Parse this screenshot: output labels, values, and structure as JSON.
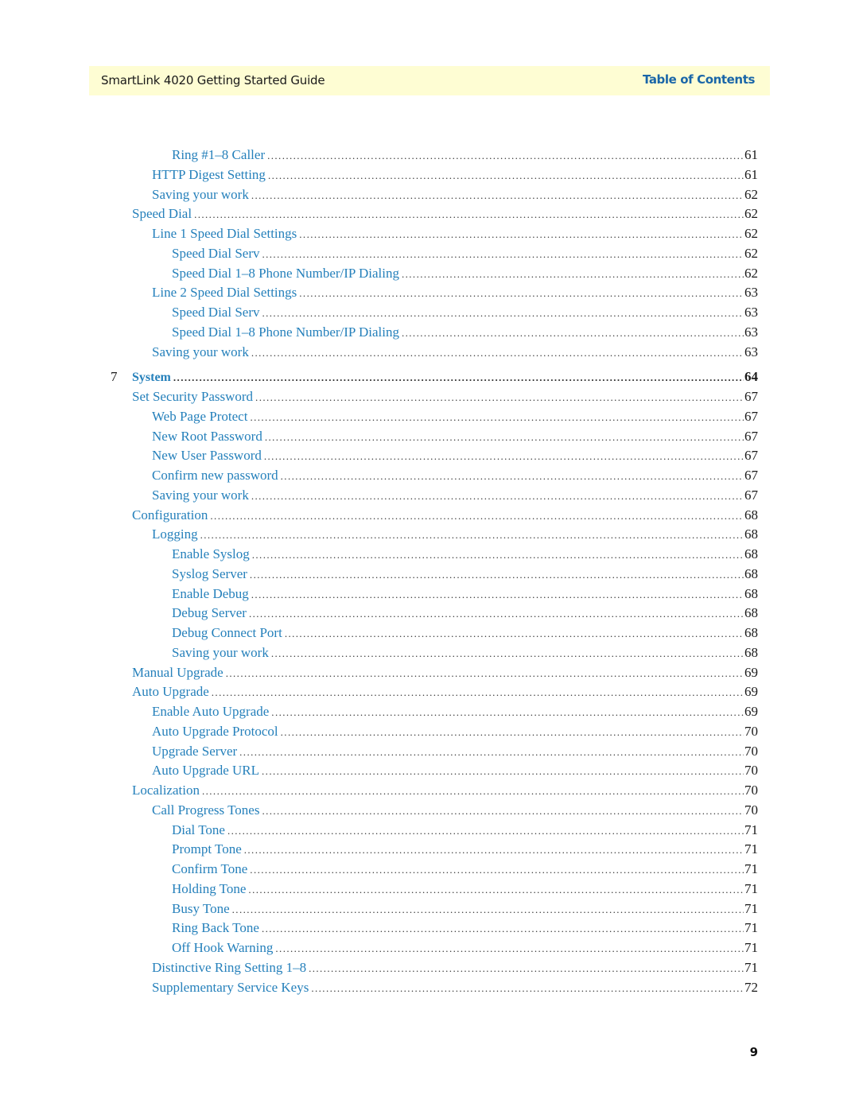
{
  "header": {
    "title": "SmartLink 4020 Getting Started Guide",
    "section": "Table of Contents"
  },
  "colors": {
    "header_background": "#fefdd3",
    "link": "#2580bb",
    "section_label": "#1a66a8",
    "text": "#1a1a1a"
  },
  "toc": [
    {
      "level": 3,
      "label": "Ring #1–8 Caller",
      "page": "61"
    },
    {
      "level": 2,
      "label": "HTTP Digest Setting",
      "page": "61"
    },
    {
      "level": 2,
      "label": "Saving your work",
      "page": "62"
    },
    {
      "level": 1,
      "label": "Speed Dial",
      "page": "62"
    },
    {
      "level": 2,
      "label": "Line 1 Speed Dial Settings",
      "page": "62"
    },
    {
      "level": 3,
      "label": "Speed Dial Serv",
      "page": "62"
    },
    {
      "level": 3,
      "label": "Speed Dial 1–8 Phone Number/IP Dialing",
      "page": "62"
    },
    {
      "level": 2,
      "label": "Line 2 Speed Dial Settings",
      "page": "63"
    },
    {
      "level": 3,
      "label": "Speed Dial Serv",
      "page": "63"
    },
    {
      "level": 3,
      "label": "Speed Dial 1–8 Phone Number/IP Dialing",
      "page": "63"
    },
    {
      "level": 2,
      "label": "Saving your work",
      "page": "63"
    },
    {
      "level": 0,
      "chapter_number": "7",
      "label": "System",
      "page": "64"
    },
    {
      "level": 1,
      "label": "Set Security Password",
      "page": "67"
    },
    {
      "level": 2,
      "label": "Web Page Protect",
      "page": "67"
    },
    {
      "level": 2,
      "label": "New Root Password",
      "page": "67"
    },
    {
      "level": 2,
      "label": "New User Password",
      "page": "67"
    },
    {
      "level": 2,
      "label": "Confirm new password",
      "page": "67"
    },
    {
      "level": 2,
      "label": "Saving your work",
      "page": "67"
    },
    {
      "level": 1,
      "label": "Configuration",
      "page": "68"
    },
    {
      "level": 2,
      "label": "Logging",
      "page": "68"
    },
    {
      "level": 3,
      "label": "Enable Syslog",
      "page": "68"
    },
    {
      "level": 3,
      "label": "Syslog Server",
      "page": "68"
    },
    {
      "level": 3,
      "label": "Enable Debug",
      "page": "68"
    },
    {
      "level": 3,
      "label": "Debug Server",
      "page": "68"
    },
    {
      "level": 3,
      "label": "Debug Connect Port",
      "page": "68"
    },
    {
      "level": 3,
      "label": "Saving your work",
      "page": "68"
    },
    {
      "level": 1,
      "label": "Manual Upgrade",
      "page": "69"
    },
    {
      "level": 1,
      "label": "Auto Upgrade",
      "page": "69"
    },
    {
      "level": 2,
      "label": "Enable Auto Upgrade",
      "page": "69"
    },
    {
      "level": 2,
      "label": "Auto Upgrade Protocol",
      "page": "70"
    },
    {
      "level": 2,
      "label": "Upgrade Server",
      "page": "70"
    },
    {
      "level": 2,
      "label": "Auto Upgrade URL",
      "page": "70"
    },
    {
      "level": 1,
      "label": "Localization",
      "page": "70"
    },
    {
      "level": 2,
      "label": "Call Progress Tones",
      "page": "70"
    },
    {
      "level": 3,
      "label": "Dial Tone",
      "page": "71"
    },
    {
      "level": 3,
      "label": "Prompt Tone",
      "page": "71"
    },
    {
      "level": 3,
      "label": "Confirm Tone",
      "page": "71"
    },
    {
      "level": 3,
      "label": "Holding Tone",
      "page": "71"
    },
    {
      "level": 3,
      "label": "Busy Tone",
      "page": "71"
    },
    {
      "level": 3,
      "label": "Ring Back Tone",
      "page": "71"
    },
    {
      "level": 3,
      "label": "Off Hook Warning",
      "page": "71"
    },
    {
      "level": 2,
      "label": "Distinctive Ring Setting 1–8",
      "page": "71"
    },
    {
      "level": 2,
      "label": "Supplementary Service Keys",
      "page": "72"
    }
  ],
  "footer": {
    "page_number": "9"
  }
}
